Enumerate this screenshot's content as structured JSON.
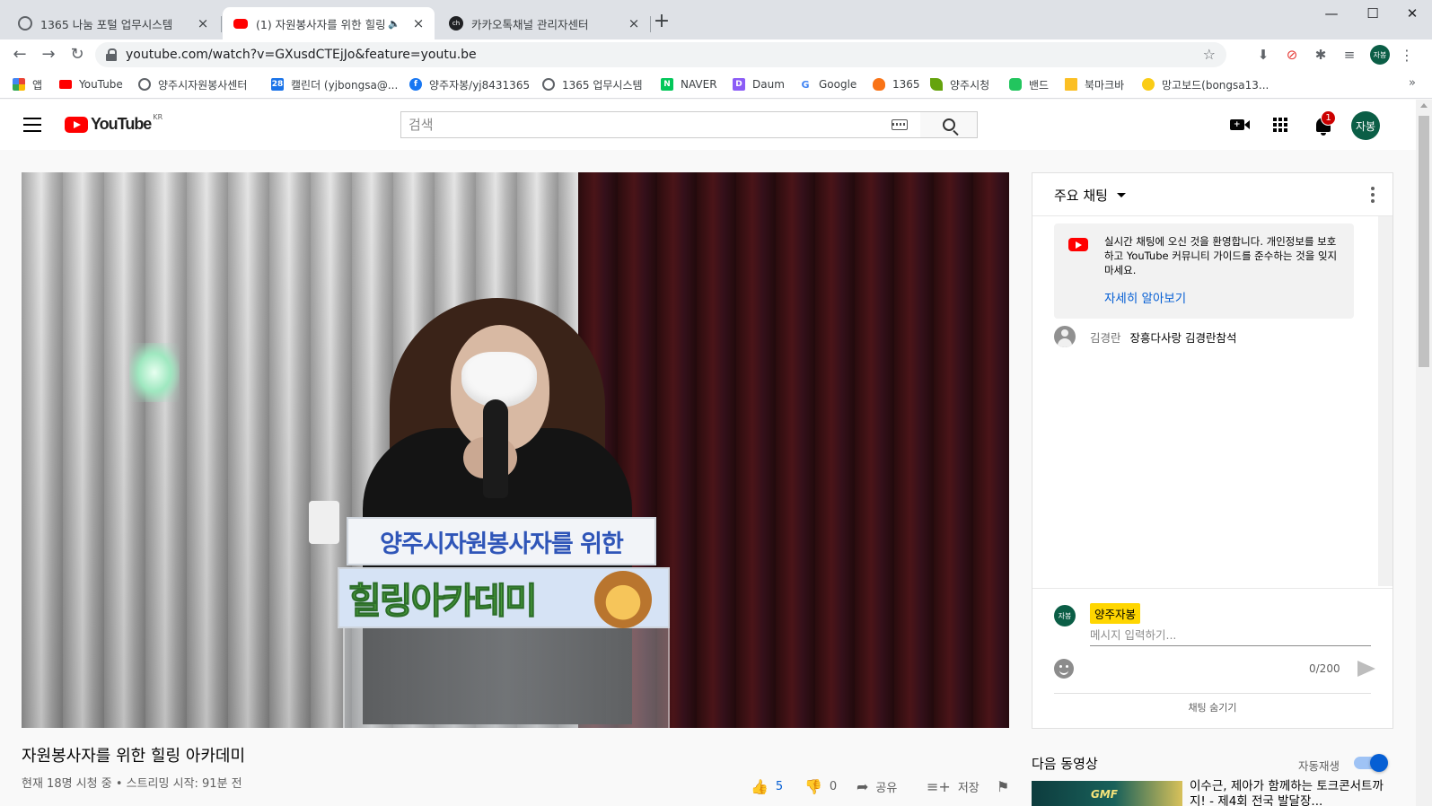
{
  "browser": {
    "tabs": [
      {
        "title": "1365 나눔 포털 업무시스템",
        "favicon_color": "#5f6368",
        "active": false
      },
      {
        "title": "(1) 자원봉사자를 위한 힐링",
        "favicon_color": "#ff0000",
        "active": true
      },
      {
        "title": "카카오톡채널 관리자센터",
        "favicon_color": "#202124",
        "active": false
      }
    ],
    "tab_close": "×",
    "new_tab": "+",
    "window_controls": {
      "minimize": "—",
      "maximize": "☐",
      "close": "✕"
    },
    "nav": {
      "back": "←",
      "forward": "→",
      "reload": "↻"
    },
    "url": "youtube.com/watch?v=GXusdCTEjJo&feature=youtu.be",
    "bookmark_star": "☆",
    "profile_initials": "자봉",
    "extensions": [
      "⬇",
      "⊘",
      "✱",
      "≡"
    ],
    "menu_dots": "⋮",
    "bookmarks": [
      {
        "label": "앱",
        "color": "#ea4335"
      },
      {
        "label": "YouTube",
        "color": "#ff0000"
      },
      {
        "label": "양주시자원봉사센터",
        "color": "#5f6368"
      },
      {
        "label": "캘린더 (yjbongsa@...",
        "color": "#1a73e8",
        "badge": "28"
      },
      {
        "label": "양주자봉/yj8431365",
        "color": "#1877f2",
        "badge": "f"
      },
      {
        "label": "1365 업무시스템",
        "color": "#5f6368"
      },
      {
        "label": "NAVER",
        "color": "#03c75a",
        "badge": "N"
      },
      {
        "label": "Daum",
        "color": "#8b5cf6",
        "badge": "D"
      },
      {
        "label": "Google",
        "color": "#4285f4",
        "badge": "G"
      },
      {
        "label": "1365",
        "color": "#f97316"
      },
      {
        "label": "양주시청",
        "color": "#65a30d"
      },
      {
        "label": "밴드",
        "color": "#22c55e"
      },
      {
        "label": "북마크바",
        "color": "#fbbf24"
      },
      {
        "label": "망고보드(bongsa13...",
        "color": "#facc15"
      }
    ],
    "bookmarks_more": "»"
  },
  "youtube": {
    "logo_text": "YouTube",
    "region": "KR",
    "search_placeholder": "검색",
    "notification_count": "1",
    "avatar_initials": "자봉",
    "accent": "#ff0000",
    "video": {
      "podium_line1": "양주시자원봉사자를 위한",
      "podium_line2": "힐링아카데미",
      "title": "자원봉사자를 위한 힐링 아카데미",
      "meta": "현재 18명 시청 중 • 스트리밍 시작: 91분 전",
      "likes": "5",
      "dislikes": "0",
      "share_label": "공유",
      "save_label": "저장",
      "icons": {
        "like": "👍",
        "dislike": "👎",
        "share": "➦",
        "save": "≡+",
        "report": "⚑"
      }
    },
    "chat": {
      "header_title": "주요 채팅",
      "welcome_text": "실시간 채팅에 오신 것을 환영합니다. 개인정보를 보호하고 YouTube 커뮤니티 가이드를 준수하는 것을 잊지 마세요.",
      "learn_more": "자세히 알아보기",
      "messages": [
        {
          "author": "김경란",
          "text": "장흥다사랑 김경란참석"
        }
      ],
      "composer": {
        "avatar_initials": "자봉",
        "channel_name": "양주자봉",
        "placeholder": "메시지 입력하기...",
        "char_count": "0/200"
      },
      "hide_chat": "채팅 숨기기"
    },
    "up_next": {
      "heading": "다음 동영상",
      "autoplay_label": "자동재생",
      "autoplay_on": true,
      "first_thumb_text": "GMF",
      "first_title": "이수근, 제아가 함께하는 토크콘서트까지! - 제4회 전국 발달장..."
    }
  }
}
